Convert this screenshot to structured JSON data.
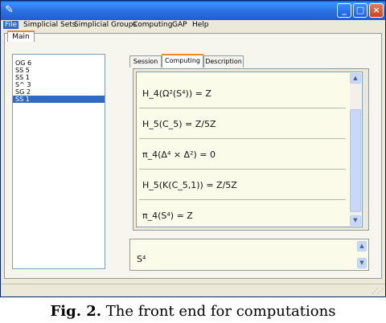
{
  "menu": [
    "File",
    "Simplicial Sets",
    "Simplicial Groups",
    "Computing",
    "GAP",
    "Help"
  ],
  "outer_tab": "Main",
  "list_items": [
    "OG 6",
    "SS 5",
    "SS 1",
    "S^ 3",
    "SG 2",
    "SS 1"
  ],
  "inner_tabs": [
    "Session",
    "Computing",
    "Description"
  ],
  "results": [
    "H_4(Ω²(S⁴)) = Z",
    "H_5(C_5) = Z/5Z",
    "π_4(Δ⁴ × Δ²) = 0",
    "H_5(K(C_5,1)) = Z/5Z",
    "π_4(S⁴) = Z"
  ],
  "input_value": "S⁴",
  "caption_prefix": "Fig. 2.",
  "caption_text": " The front end for computations",
  "window_controls": [
    "minimize-icon",
    "maximize-icon",
    "close-icon"
  ]
}
